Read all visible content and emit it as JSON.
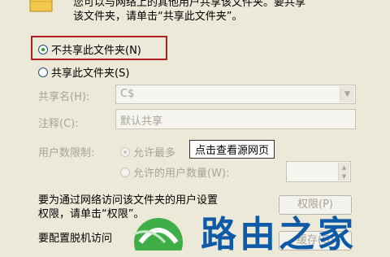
{
  "intro": {
    "line1": "您可以与网络上的其他用户共享该文件夹。要共享",
    "line2": "该文件夹，请单击“共享此文件夹”。"
  },
  "options": {
    "not_share": "不共享此文件夹(N)",
    "share": "共享此文件夹(S)"
  },
  "fields": {
    "share_name_label": "共享名(H):",
    "share_name_value": "C$",
    "comment_label": "注释(C):",
    "comment_value": "默认共享",
    "user_limit_label": "用户数限制:",
    "allow_max": "允许最多",
    "allow_users": "允许的用户数量(W):"
  },
  "tooltip": "点击查看源网页",
  "permissions": {
    "text1": "要为通过网络访问该文件夹的用户设置",
    "text2": "权限，请单击“权限”。",
    "button": "权限(P)"
  },
  "offline": {
    "text": "要配置脱机访问",
    "button_partial": "缓存(G)"
  },
  "watermark": {
    "text": "路由之家"
  }
}
